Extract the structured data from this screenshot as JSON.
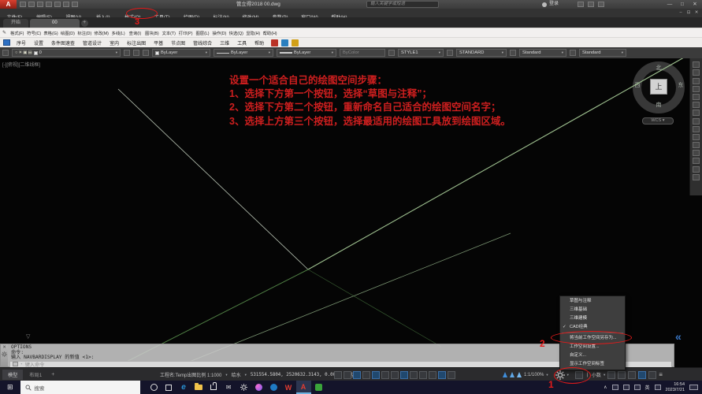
{
  "colors": {
    "annotation_red": "#e51a1a",
    "line_green": "#5e8f53",
    "line_pale_green": "#9dbf8e",
    "line_white": "#b9c4b4",
    "taskbar_active_border": "#6fb3e0"
  },
  "titlebar": {
    "logo": "A",
    "title": "管立得2018    00.dwg",
    "search_placeholder": "输入关键字或短语",
    "signin": "登录"
  },
  "window": {
    "minimize": "—",
    "maximize": "□",
    "close": "✕",
    "doc_minimize": "–",
    "doc_restore": "⊡",
    "doc_close": "✕"
  },
  "menubar": {
    "items": [
      "文件(F)",
      "编辑(E)",
      "视图(V)",
      "插入(I)",
      "格式(O)",
      "工具(T)",
      "绘图(D)",
      "标注(N)",
      "修改(M)",
      "参数(P)",
      "窗口(W)",
      "帮助(H)"
    ]
  },
  "filetabs": {
    "start": "开始",
    "doc": "00",
    "add": "+"
  },
  "menubar2": {
    "items": [
      "格式(F)",
      "符号(C)",
      "表格(G)",
      "绘图(D)",
      "标注(D)",
      "修改(M)",
      "多线(L)",
      "查询(I)",
      "图块(B)",
      "文本(T)",
      "打印(P)",
      "图层(L)",
      "操作(D)",
      "快选(Q)",
      "显隐(H)",
      "帮助(H)"
    ]
  },
  "plugin_toolbar": {
    "items": [
      "序号",
      "设置",
      "条件图速查",
      "管道设计",
      "室内",
      "标注出图",
      "平基",
      "节点图",
      "管线综合",
      "三维",
      "工具",
      "帮助"
    ]
  },
  "props": {
    "layer": "0",
    "color": "ByLayer",
    "linetype": "ByLayer",
    "lineweight": "ByLayer",
    "plotstyle": "ByColor",
    "textstyle": "STYLE1",
    "dimstyle": "STANDARD",
    "tablestyle": "Standard",
    "mleaderstyle": "Standard"
  },
  "canvas": {
    "viewport_label": "[-][俯视][二维线框]",
    "notes": [
      "设置一个适合自己的绘图空间步骤：",
      "1、选择下方第一个按钮，选择“草图与注释”；",
      "2、选择下方第二个按钮，重新命名自己适合的绘图空间名字；",
      "3、选择上方第三个按钮，选择最适用的绘图工具放到绘图区域。"
    ],
    "compass": {
      "n": "北",
      "s": "南",
      "w": "西",
      "e": "东",
      "up": "上",
      "ucs": "WCS"
    }
  },
  "command": {
    "line1": "OPTIONS",
    "line2": "命令:",
    "line3": "输入 NAVBARDISPLAY 的新值 <1>:",
    "placeholder": "键入命令"
  },
  "workspace_menu": {
    "item1": "草图与注释",
    "item2": "三维基础",
    "item3": "三维建模",
    "item4": "CAD经典",
    "item5": "将当前工作空间另存为...",
    "item6": "工作空间设置...",
    "item7": "自定义...",
    "item8": "显示工作空间标签"
  },
  "statusbar": {
    "model": "模型",
    "layout": "布局1",
    "add": "+",
    "project": "工程名:Temp出图比例 1:1000",
    "discipline": "给水",
    "coords": "531554.5804, 2520632.3143, 0.0000",
    "space": "模型",
    "scale": "1:1/100%",
    "precision": "小数"
  },
  "taskbar": {
    "search": "搜索",
    "edge": "e",
    "wps": "W",
    "acad": "A",
    "lang": "英",
    "time": "16:54",
    "date": "2023/7/21"
  },
  "annotations": {
    "n1": "1",
    "n2": "2",
    "n3": "3"
  },
  "glyphs": {
    "dropdown": "▾",
    "check": "✓",
    "close": "✕",
    "grip": "▽",
    "collapse": "«",
    "minimize": "—",
    "maximize": "□",
    "doc_min": "–",
    "doc_restore": "⊡",
    "plus": "+",
    "start": "⊞",
    "tray_up": "∧",
    "pencil": "✎",
    "mail": "✉",
    "bar": "❘",
    "menu": "≡",
    "sun": "☀",
    "bulb": "○",
    "lock": "▣",
    "print": "▤"
  }
}
